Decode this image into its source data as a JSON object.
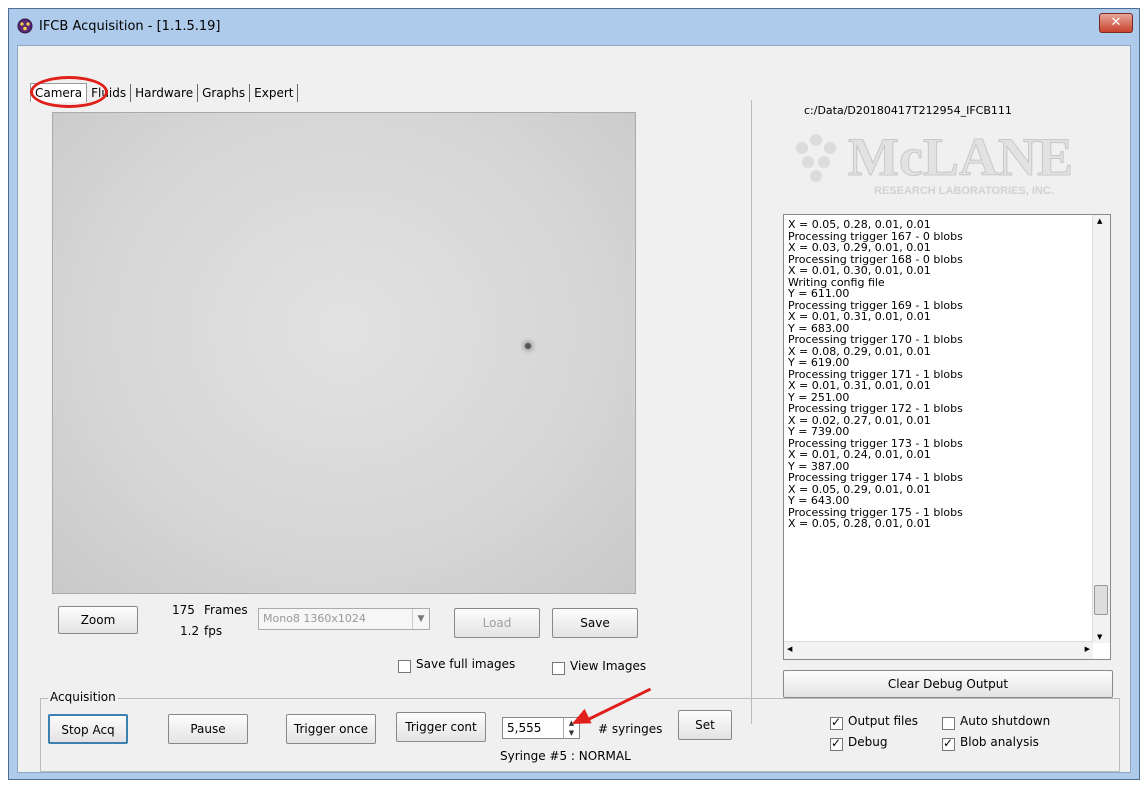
{
  "window": {
    "title": "IFCB Acquisition - [1.1.5.19]",
    "close_glyph": "✕"
  },
  "tabs": [
    "Camera",
    "Fluids",
    "Hardware",
    "Graphs",
    "Expert"
  ],
  "camera": {
    "zoom_label": "Zoom",
    "frames_count": "175",
    "frames_label": "Frames",
    "fps_value": "1.2",
    "fps_label": "fps",
    "format_selected": "Mono8 1360x1024",
    "load_label": "Load",
    "save_label": "Save",
    "save_full_images_label": "Save full images",
    "save_full_images_checked": false,
    "view_images_label": "View Images",
    "view_images_checked": false
  },
  "right_panel": {
    "data_path": "c:/Data/D20180417T212954_IFCB111",
    "logo_main": "McLANE",
    "logo_sub": "RESEARCH LABORATORIES, INC.",
    "debug_lines": [
      "X = 0.05, 0.28, 0.01, 0.01",
      "Processing trigger 167 - 0 blobs",
      "X = 0.03, 0.29, 0.01, 0.01",
      "Processing trigger 168 - 0 blobs",
      "X = 0.01, 0.30, 0.01, 0.01",
      "Writing config file",
      "Y = 611.00",
      "Processing trigger 169 - 1 blobs",
      "X = 0.01, 0.31, 0.01, 0.01",
      "Y = 683.00",
      "Processing trigger 170 - 1 blobs",
      "X = 0.08, 0.29, 0.01, 0.01",
      "Y = 619.00",
      "Processing trigger 171 - 1 blobs",
      "X = 0.01, 0.31, 0.01, 0.01",
      "Y = 251.00",
      "Processing trigger 172 - 1 blobs",
      "X = 0.02, 0.27, 0.01, 0.01",
      "Y = 739.00",
      "Processing trigger 173 - 1 blobs",
      "X = 0.01, 0.24, 0.01, 0.01",
      "Y = 387.00",
      "Processing trigger 174 - 1 blobs",
      "X = 0.05, 0.29, 0.01, 0.01",
      "Y = 643.00",
      "Processing trigger 175 - 1 blobs",
      "X = 0.05, 0.28, 0.01, 0.01"
    ],
    "clear_debug_label": "Clear Debug Output"
  },
  "acquisition": {
    "group_title": "Acquisition",
    "stop_acq_label": "Stop Acq",
    "pause_label": "Pause",
    "trigger_once_label": "Trigger once",
    "trigger_cont_label": "Trigger cont",
    "syringes_value": "5,555",
    "syringes_label": "# syringes",
    "set_label": "Set",
    "syringe_status": "Syringe #5 : NORMAL",
    "output_files_label": "Output files",
    "output_files_checked": true,
    "auto_shutdown_label": "Auto shutdown",
    "auto_shutdown_checked": false,
    "debug_label": "Debug",
    "debug_checked": true,
    "blob_analysis_label": "Blob analysis",
    "blob_analysis_checked": true
  },
  "colors": {
    "annotation": "#e0201a",
    "title_bar": "#aecbeb",
    "client_bg": "#f0f0f0"
  }
}
